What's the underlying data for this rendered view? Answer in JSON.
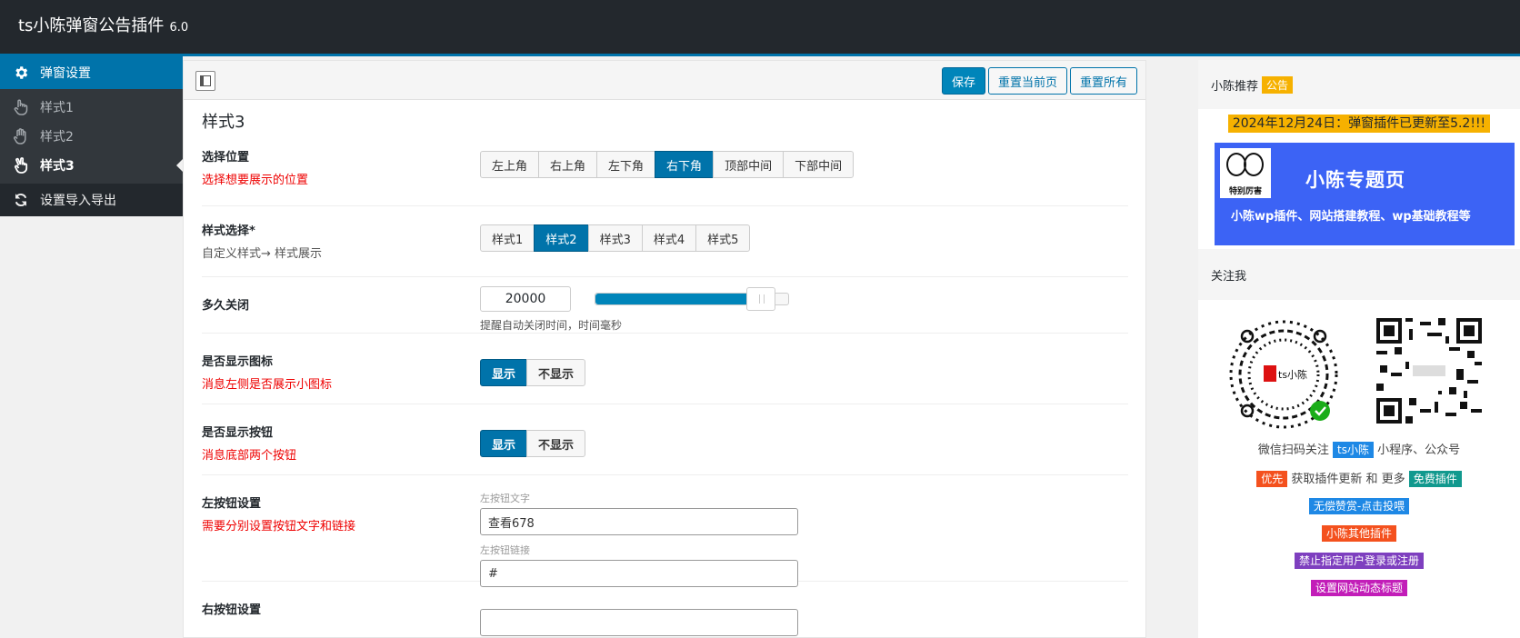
{
  "header": {
    "title": "ts小陈弹窗公告插件",
    "version": "6.0"
  },
  "sidebar": {
    "main_item": "弹窗设置",
    "sub_items": [
      "样式1",
      "样式2",
      "样式3"
    ],
    "current_sub": "样式3",
    "io_item": "设置导入导出"
  },
  "toolbar": {
    "save": "保存",
    "reset_page": "重置当前页",
    "reset_all": "重置所有"
  },
  "page": {
    "section_title": "样式3"
  },
  "fields": {
    "position": {
      "label": "选择位置",
      "desc": "选择想要展示的位置",
      "options": [
        "左上角",
        "右上角",
        "左下角",
        "右下角",
        "顶部中间",
        "下部中间"
      ],
      "selected": "右下角"
    },
    "style": {
      "label": "样式选择*",
      "desc": "自定义样式→ 样式展示",
      "options": [
        "样式1",
        "样式2",
        "样式3",
        "样式4",
        "样式5"
      ],
      "selected": "样式2"
    },
    "close_time": {
      "label": "多久关闭",
      "value": "20000",
      "slider_fraction": 0.86,
      "hint": "提醒自动关闭时间，时间毫秒"
    },
    "show_icon": {
      "label": "是否显示图标",
      "desc": "消息左侧是否展示小图标",
      "on": "显示",
      "off": "不显示"
    },
    "show_buttons": {
      "label": "是否显示按钮",
      "desc": "消息底部两个按钮",
      "on": "显示",
      "off": "不显示"
    },
    "left_button": {
      "label": "左按钮设置",
      "desc": "需要分别设置按钮文字和链接",
      "text_label": "左按钮文字",
      "text_value": "查看678",
      "link_label": "左按钮链接",
      "link_value": "#"
    },
    "right_button": {
      "label": "右按钮设置"
    }
  },
  "aside": {
    "recommend": "小陈推荐",
    "recommend_badge": "公告",
    "notice": "2024年12月24日：弹窗插件已更新至5.2!!!",
    "banner_caption": "特别厉害",
    "banner_title": "小陈专题页",
    "banner_sub": "小陈wp插件、网站搭建教程、wp基础教程等",
    "follow": "关注我",
    "wechat_pre": "微信扫码关注",
    "wechat_badge": "ts小陈",
    "wechat_post": "小程序、公众号",
    "priority_badge": "优先",
    "priority_mid": "获取插件更新 和 更多",
    "free_badge": "免费插件",
    "link1": "无偿赞赏-点击投喂",
    "link2": "小陈其他插件",
    "link3": "禁止指定用户登录或注册",
    "link4": "设置网站动态标题"
  },
  "colors": {
    "accent": "#0073aa",
    "dark": "#23282d",
    "red": "#ee0000",
    "notice_bg": "#f6b100",
    "banner": "#3c63f5"
  }
}
